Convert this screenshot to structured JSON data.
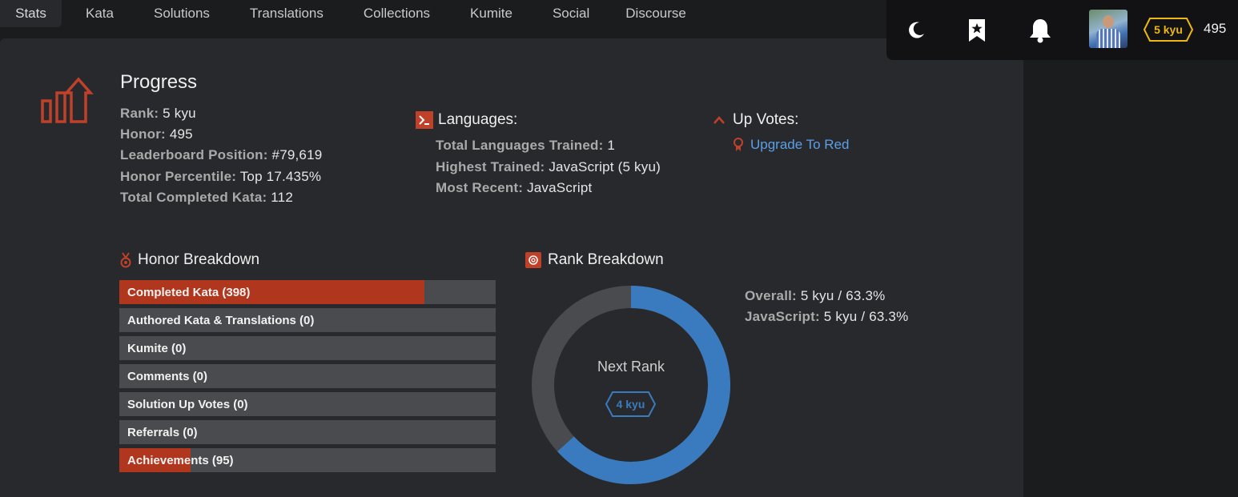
{
  "nav": {
    "tabs": [
      {
        "label": "Stats"
      },
      {
        "label": "Kata"
      },
      {
        "label": "Solutions"
      },
      {
        "label": "Translations"
      },
      {
        "label": "Collections"
      },
      {
        "label": "Kumite"
      },
      {
        "label": "Social"
      },
      {
        "label": "Discourse"
      }
    ]
  },
  "topbar": {
    "icons": [
      "moon-icon",
      "bookmark-star-icon",
      "bell-icon"
    ],
    "rank_badge": "5 kyu",
    "honor": "495",
    "badge_color": "#ecb613"
  },
  "progress": {
    "title": "Progress",
    "stats": [
      {
        "label": "Rank:",
        "value": "5 kyu"
      },
      {
        "label": "Honor:",
        "value": "495"
      },
      {
        "label": "Leaderboard Position:",
        "value": "#79,619"
      },
      {
        "label": "Honor Percentile:",
        "value": "Top 17.435%"
      },
      {
        "label": "Total Completed Kata:",
        "value": "112"
      }
    ]
  },
  "languages": {
    "title": "Languages:",
    "stats": [
      {
        "label": "Total Languages Trained:",
        "value": "1"
      },
      {
        "label": "Highest Trained:",
        "value": "JavaScript (5 kyu)"
      },
      {
        "label": "Most Recent:",
        "value": "JavaScript"
      }
    ]
  },
  "upvotes": {
    "title": "Up Votes:",
    "link": "Upgrade To Red"
  },
  "honor_breakdown": {
    "title": "Honor Breakdown",
    "bars": [
      {
        "label": "Completed Kata (398)",
        "fill": 0.81
      },
      {
        "label": "Authored Kata & Translations (0)",
        "fill": 0
      },
      {
        "label": "Kumite (0)",
        "fill": 0
      },
      {
        "label": "Comments (0)",
        "fill": 0
      },
      {
        "label": "Solution Up Votes (0)",
        "fill": 0
      },
      {
        "label": "Referrals (0)",
        "fill": 0
      },
      {
        "label": "Achievements (95)",
        "fill": 0.19
      }
    ]
  },
  "rank_breakdown": {
    "title": "Rank Breakdown",
    "progress_fraction": 0.633,
    "next_rank_label": "Next Rank",
    "next_rank": "4 kyu",
    "stats": [
      {
        "label": "Overall:",
        "value": "5 kyu / 63.3%"
      },
      {
        "label": "JavaScript:",
        "value": "5 kyu / 63.3%"
      }
    ]
  },
  "colors": {
    "accent": "#c0412a",
    "progress_blue": "#3a7bbf",
    "link": "#5b9fe6"
  }
}
